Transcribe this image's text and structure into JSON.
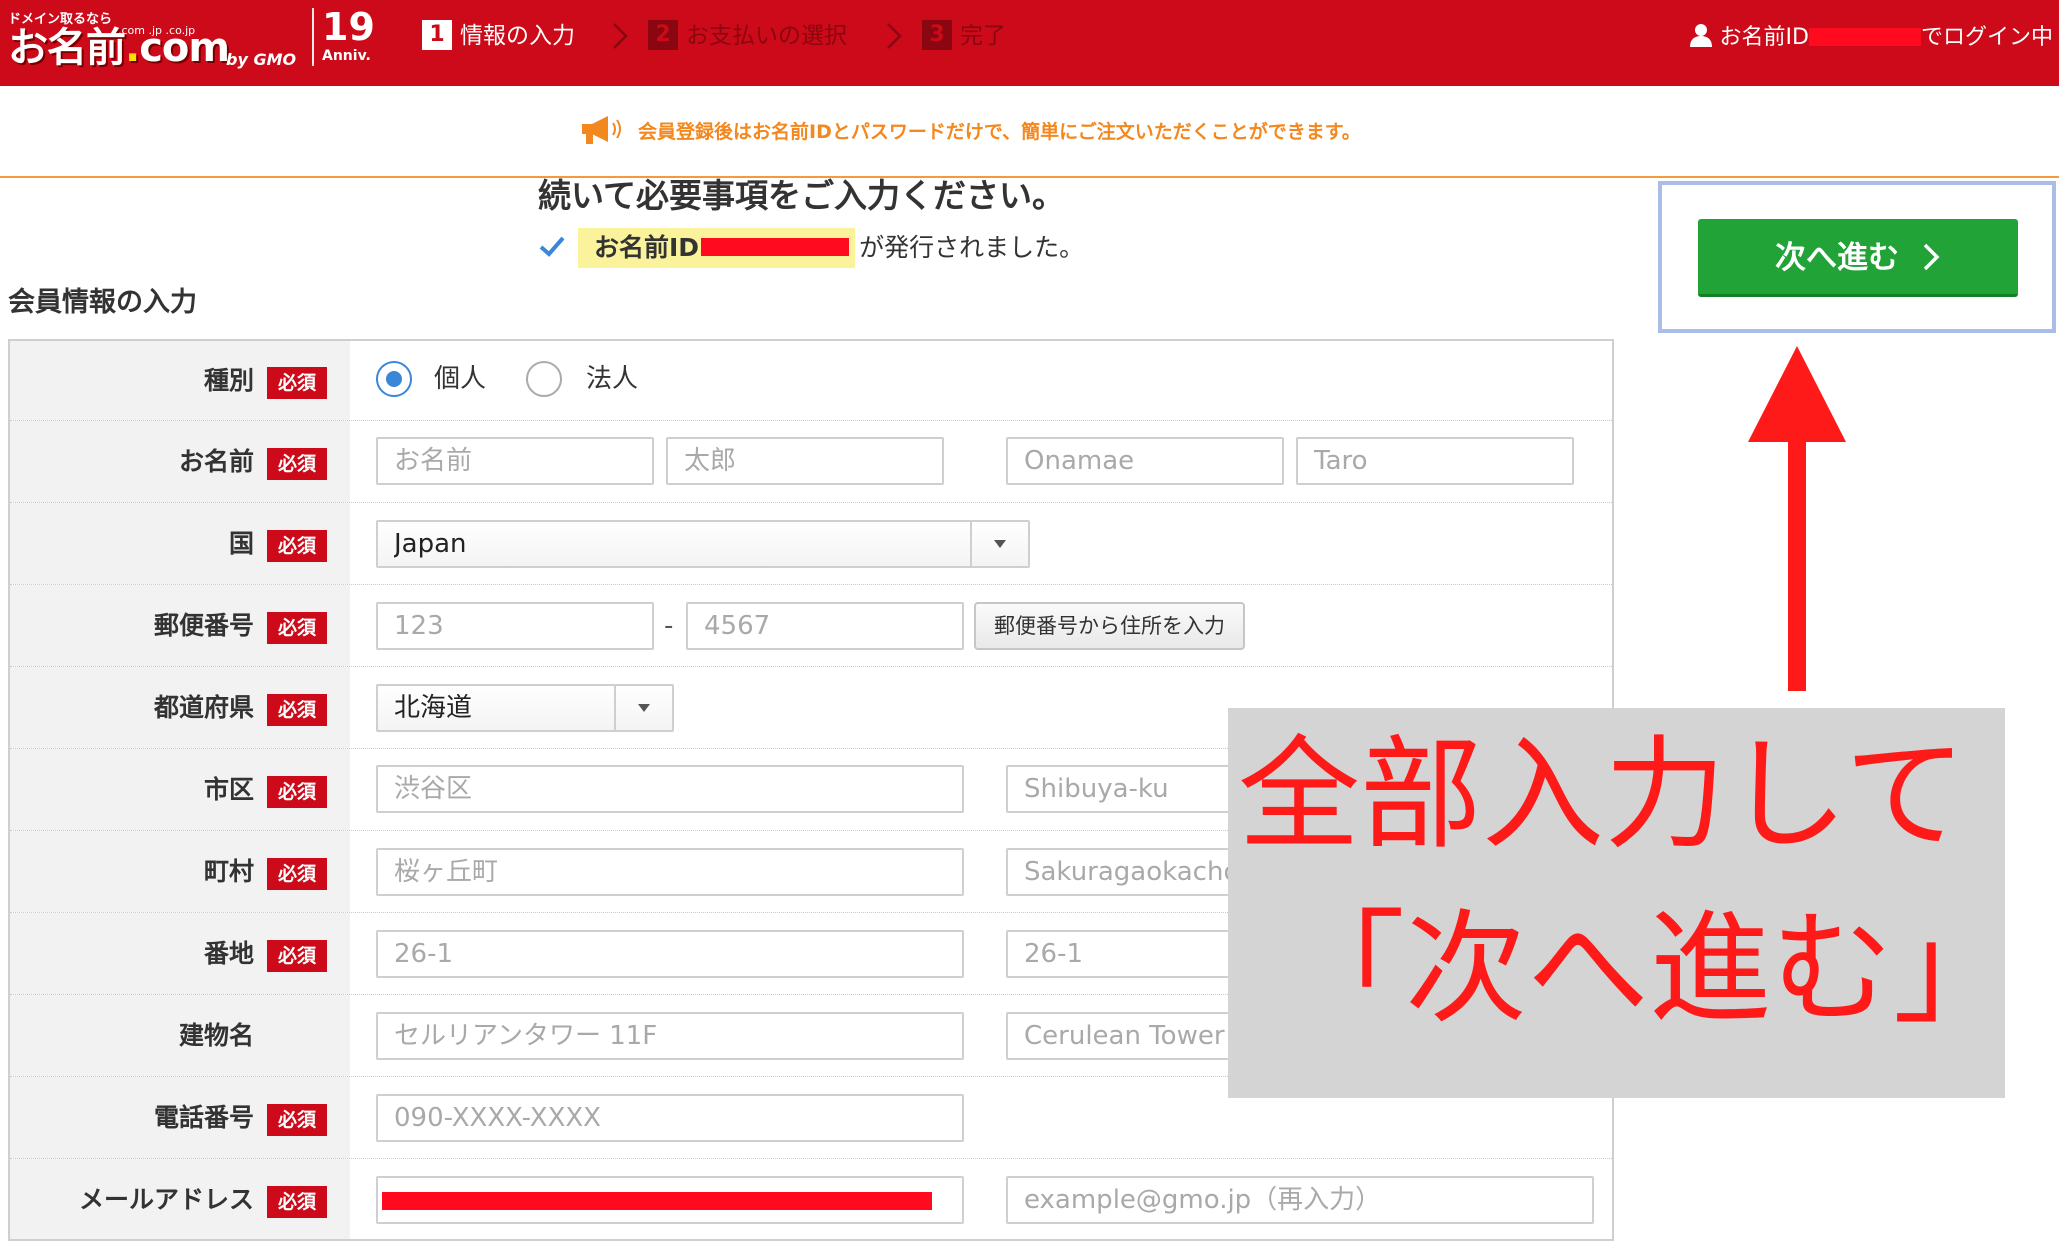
{
  "header": {
    "logo_small": "ドメイン取るなら",
    "logo_main_a": "お名前",
    "logo_main_dot": ".",
    "logo_main_b": "com",
    "logo_tlds": ".com .jp .co.jp",
    "logo_suffix": "by GMO",
    "anniv_number": "19",
    "anniv_label": "Anniv.",
    "steps": [
      {
        "number": "1",
        "label": "情報の入力",
        "state": "active"
      },
      {
        "number": "2",
        "label": "お支払いの選択",
        "state": "inactive"
      },
      {
        "number": "3",
        "label": "完了",
        "state": "inactive"
      }
    ],
    "login_prefix": "お名前ID",
    "login_suffix": "でログイン中"
  },
  "notice": {
    "text": "会員登録後はお名前IDとパスワードだけで、簡単にご注文いただくことができます。",
    "icon": "megaphone-icon"
  },
  "intro": {
    "title": "続いて必要事項をご入力ください。",
    "issued_id_label": "お名前ID",
    "issued_text": "が発行されました。"
  },
  "section_title": "会員情報の入力",
  "required_badge": "必須",
  "form": {
    "type": {
      "label": "種別",
      "options": [
        "個人",
        "法人"
      ],
      "selected": "個人"
    },
    "name": {
      "label": "お名前",
      "placeholders": [
        "お名前",
        "太郎",
        "Onamae",
        "Taro"
      ]
    },
    "country": {
      "label": "国",
      "value": "Japan"
    },
    "postal": {
      "label": "郵便番号",
      "placeholders": [
        "123",
        "4567"
      ],
      "dash": "-",
      "button": "郵便番号から住所を入力"
    },
    "prefecture": {
      "label": "都道府県",
      "value": "北海道"
    },
    "city": {
      "label": "市区",
      "placeholders": [
        "渋谷区",
        "Shibuya-ku"
      ]
    },
    "town": {
      "label": "町村",
      "placeholders": [
        "桜ヶ丘町",
        "Sakuragaokacho"
      ]
    },
    "street": {
      "label": "番地",
      "placeholders": [
        "26-1",
        "26-1"
      ]
    },
    "building": {
      "label": "建物名",
      "placeholders": [
        "セルリアンタワー 11F",
        "Cerulean Tower"
      ]
    },
    "phone": {
      "label": "電話番号",
      "placeholders": [
        "090-XXXX-XXXX"
      ]
    },
    "email": {
      "label": "メールアドレス",
      "confirm_placeholder": "example@gmo.jp（再入力）"
    }
  },
  "next_button": {
    "label": "次へ進む"
  },
  "annotation": {
    "line1": "全部入力して",
    "line2": "「次へ進む」",
    "color": "#ff1a1a"
  },
  "colors": {
    "brand_red": "#cc0a19",
    "accent_orange": "#f3881e",
    "next_green": "#21a338",
    "radio_blue": "#3a86d8"
  }
}
